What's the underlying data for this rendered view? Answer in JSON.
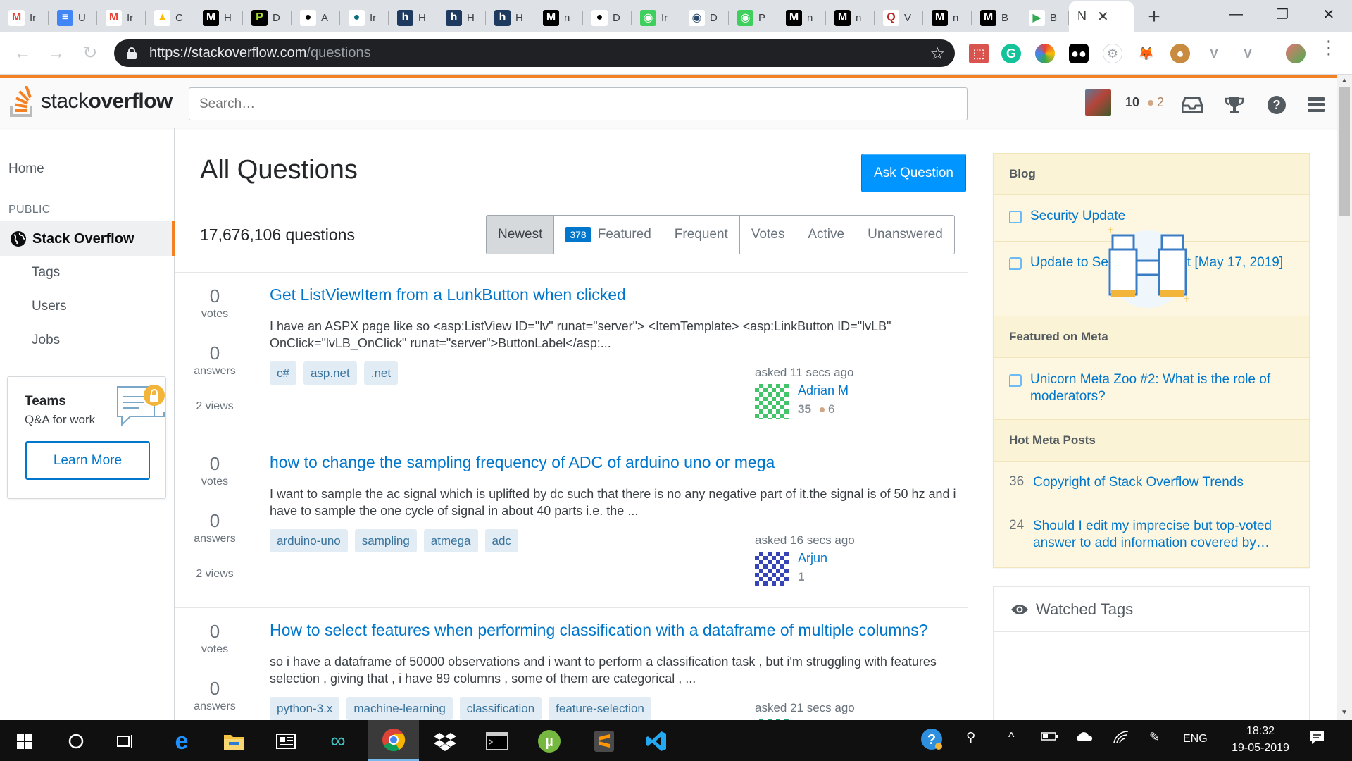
{
  "browser": {
    "tabs": [
      {
        "icon": "gmail-icon",
        "letter": "M",
        "bg": "#ffffff",
        "fg": "#ea4335",
        "title": "Ir"
      },
      {
        "icon": "docs-icon",
        "letter": "≡",
        "bg": "#4285f4",
        "fg": "#ffffff",
        "title": "U"
      },
      {
        "icon": "gmail-icon",
        "letter": "M",
        "bg": "#ffffff",
        "fg": "#ea4335",
        "title": "Ir"
      },
      {
        "icon": "drive-icon",
        "letter": "▲",
        "bg": "#ffffff",
        "fg": "#fbbc04",
        "title": "C"
      },
      {
        "icon": "medium-icon",
        "letter": "M",
        "bg": "#000000",
        "fg": "#ffffff",
        "title": "H"
      },
      {
        "icon": "p-icon",
        "letter": "P",
        "bg": "#000000",
        "fg": "#a6e22e",
        "title": "D"
      },
      {
        "icon": "github-icon",
        "letter": "●",
        "bg": "#ffffff",
        "fg": "#000000",
        "title": "A"
      },
      {
        "icon": "hashnode-icon",
        "letter": "●",
        "bg": "#ffffff",
        "fg": "#0a6a80",
        "title": "Ir"
      },
      {
        "icon": "hackernoon-icon",
        "letter": "h",
        "bg": "#1f3a5f",
        "fg": "#ffffff",
        "title": "H"
      },
      {
        "icon": "hackernoon-icon",
        "letter": "h",
        "bg": "#1f3a5f",
        "fg": "#ffffff",
        "title": "H"
      },
      {
        "icon": "hackernoon-icon",
        "letter": "h",
        "bg": "#1f3a5f",
        "fg": "#ffffff",
        "title": "H"
      },
      {
        "icon": "medium-icon",
        "letter": "M",
        "bg": "#000000",
        "fg": "#ffffff",
        "title": "n"
      },
      {
        "icon": "github-icon",
        "letter": "●",
        "bg": "#ffffff",
        "fg": "#000000",
        "title": "D"
      },
      {
        "icon": "green-app-icon",
        "letter": "◉",
        "bg": "#3ecf5c",
        "fg": "#ffffff",
        "title": "Ir"
      },
      {
        "icon": "camera-icon",
        "letter": "◉",
        "bg": "#ffffff",
        "fg": "#2b4a6b",
        "title": "D"
      },
      {
        "icon": "green-app-icon",
        "letter": "◉",
        "bg": "#3ecf5c",
        "fg": "#ffffff",
        "title": "P"
      },
      {
        "icon": "medium-icon",
        "letter": "M",
        "bg": "#000000",
        "fg": "#ffffff",
        "title": "n"
      },
      {
        "icon": "medium-icon",
        "letter": "M",
        "bg": "#000000",
        "fg": "#ffffff",
        "title": "n"
      },
      {
        "icon": "quora-icon",
        "letter": "Q",
        "bg": "#ffffff",
        "fg": "#b92b27",
        "title": "V"
      },
      {
        "icon": "medium-icon",
        "letter": "M",
        "bg": "#000000",
        "fg": "#ffffff",
        "title": "n"
      },
      {
        "icon": "medium-icon",
        "letter": "M",
        "bg": "#000000",
        "fg": "#ffffff",
        "title": "B"
      },
      {
        "icon": "play-icon",
        "letter": "▶",
        "bg": "#ffffff",
        "fg": "#34a853",
        "title": "B"
      }
    ],
    "active_tab": {
      "title": "N",
      "close": "✕"
    },
    "new_tab": "+",
    "window": {
      "minimize": "—",
      "restore": "❐",
      "close": "✕"
    },
    "url_host": "https://stackoverflow.com",
    "url_path": "/questions",
    "back": "←",
    "forward": "→",
    "reload": "↻",
    "star": "☆",
    "menu": "⋮"
  },
  "so_header": {
    "logo_light": "stack",
    "logo_bold": "overflow",
    "search_placeholder": "Search…",
    "reputation": "10",
    "bronze_badges": "2",
    "accent": "#f48024"
  },
  "leftnav": {
    "home": "Home",
    "public": "PUBLIC",
    "stack_overflow": "Stack Overflow",
    "tags": "Tags",
    "users": "Users",
    "jobs": "Jobs",
    "teams_title": "Teams",
    "teams_sub": "Q&A for work",
    "learn_more": "Learn More"
  },
  "main": {
    "title": "All Questions",
    "ask_button": "Ask Question",
    "question_count": "17,676,106 questions",
    "filters": {
      "newest": "Newest",
      "featured_badge": "378",
      "featured": "Featured",
      "frequent": "Frequent",
      "votes": "Votes",
      "active": "Active",
      "unanswered": "Unanswered"
    },
    "votes_label": "votes",
    "answers_label": "answers",
    "questions": [
      {
        "votes": "0",
        "answers": "0",
        "views": "2 views",
        "title": "Get ListViewItem from a LunkButton when clicked",
        "excerpt": "I have an ASPX page like so <asp:ListView ID=\"lv\" runat=\"server\"> <ItemTemplate> <asp:LinkButton ID=\"lvLB\" OnClick=\"lvLB_OnClick\" runat=\"server\">ButtonLabel</asp:...",
        "tags": [
          "c#",
          "asp.net",
          ".net"
        ],
        "asked": "asked 11 secs ago",
        "user": "Adrian M",
        "rep": "35",
        "bronze": "6"
      },
      {
        "votes": "0",
        "answers": "0",
        "views": "2 views",
        "title": "how to change the sampling frequency of ADC of arduino uno or mega",
        "excerpt": "I want to sample the ac signal which is uplifted by dc such that there is no any negative part of it.the signal is of 50 hz and i have to sample the one cycle of signal in about 40 parts i.e. the ...",
        "tags": [
          "arduino-uno",
          "sampling",
          "atmega",
          "adc"
        ],
        "asked": "asked 16 secs ago",
        "user": "Arjun",
        "rep": "1",
        "bronze": ""
      },
      {
        "votes": "0",
        "answers": "0",
        "views": "",
        "title": "How to select features when performing classification with a dataframe of multiple columns?",
        "excerpt": "so i have a dataframe of 50000 observations and i want to perform a classification task , but i'm struggling with features selection , giving that , i have 89 columns , some of them are categorical , ...",
        "tags": [
          "python-3.x",
          "machine-learning",
          "classification",
          "feature-selection"
        ],
        "asked": "asked 21 secs ago",
        "user": "",
        "rep": "",
        "bronze": ""
      }
    ]
  },
  "sidebar": {
    "blog_head": "Blog",
    "blog_items": [
      "Security Update",
      "Update to Security Incident [May 17, 2019]"
    ],
    "meta_head": "Featured on Meta",
    "meta_items": [
      "Unicorn Meta Zoo #2: What is the role of moderators?"
    ],
    "hot_head": "Hot Meta Posts",
    "hot_items": [
      {
        "num": "36",
        "text": "Copyright of Stack Overflow Trends"
      },
      {
        "num": "24",
        "text": "Should I edit my imprecise but top-voted answer to add information covered by…"
      }
    ],
    "watched_tags": "Watched Tags"
  },
  "taskbar": {
    "language": "ENG",
    "time": "18:32",
    "date": "19-05-2019"
  }
}
